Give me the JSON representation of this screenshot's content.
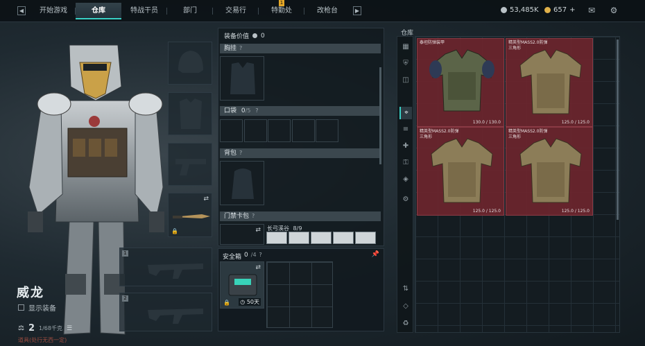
{
  "topbar": {
    "tabs": [
      {
        "label": "开始游戏",
        "active": false
      },
      {
        "label": "仓库",
        "active": true
      },
      {
        "label": "特战干员",
        "active": false
      },
      {
        "label": "部门",
        "active": false
      },
      {
        "label": "交易行",
        "active": false
      },
      {
        "label": "特勤处",
        "active": false,
        "badge": "1"
      },
      {
        "label": "改枪台",
        "active": false
      }
    ],
    "currency_1": "53,485K",
    "currency_2": "657",
    "currency_2_add": "+",
    "mail_icon": "mail-icon",
    "settings_icon": "gear-icon"
  },
  "operator": {
    "name": "威龙",
    "show_gear_label": "显示装备",
    "level": "2",
    "capacity": "1/68千克",
    "note": "道具(处行无西一定)"
  },
  "left_slots": {
    "slot3_num": "1",
    "slot4_num": "2",
    "swap_icon": "swap-icon",
    "lock_icon": "lock-icon"
  },
  "center": {
    "value_label": "装备价值",
    "value": "0",
    "sections": {
      "chest_rig": "胸挂",
      "pockets": "口袋",
      "pockets_count": "0",
      "pockets_total": "/5",
      "backpack": "背包",
      "keycard": "门禁卡包",
      "keycard_label": "长弓溪谷",
      "keycard_count": "8/9",
      "safebox": "安全箱",
      "safebox_count": "0",
      "safebox_total": "/4",
      "safebox_time": "50天"
    },
    "help": "?"
  },
  "warehouse": {
    "title": "仓库",
    "items": [
      {
        "name": "泰坦防弹装甲",
        "sub": "",
        "durability": "130.0 / 130.0"
      },
      {
        "name": "精英型MASS2.0防弹",
        "sub": "三角形",
        "durability": "125.0 / 125.0"
      },
      {
        "name": "精英型MASS2.0防弹",
        "sub": "三角形",
        "durability": "125.0 / 125.0"
      },
      {
        "name": "精英型MASS2.0防弹",
        "sub": "三角形",
        "durability": "125.0 / 125.0"
      }
    ],
    "sidebar_icons": [
      "grid-icon",
      "armor-icon",
      "backpack-icon",
      "weapon-icon",
      "ammo-icon",
      "medical-icon",
      "key-icon",
      "misc-icon",
      "settings-icon",
      "sort-icon",
      "layers-icon",
      "recycle-icon"
    ]
  }
}
